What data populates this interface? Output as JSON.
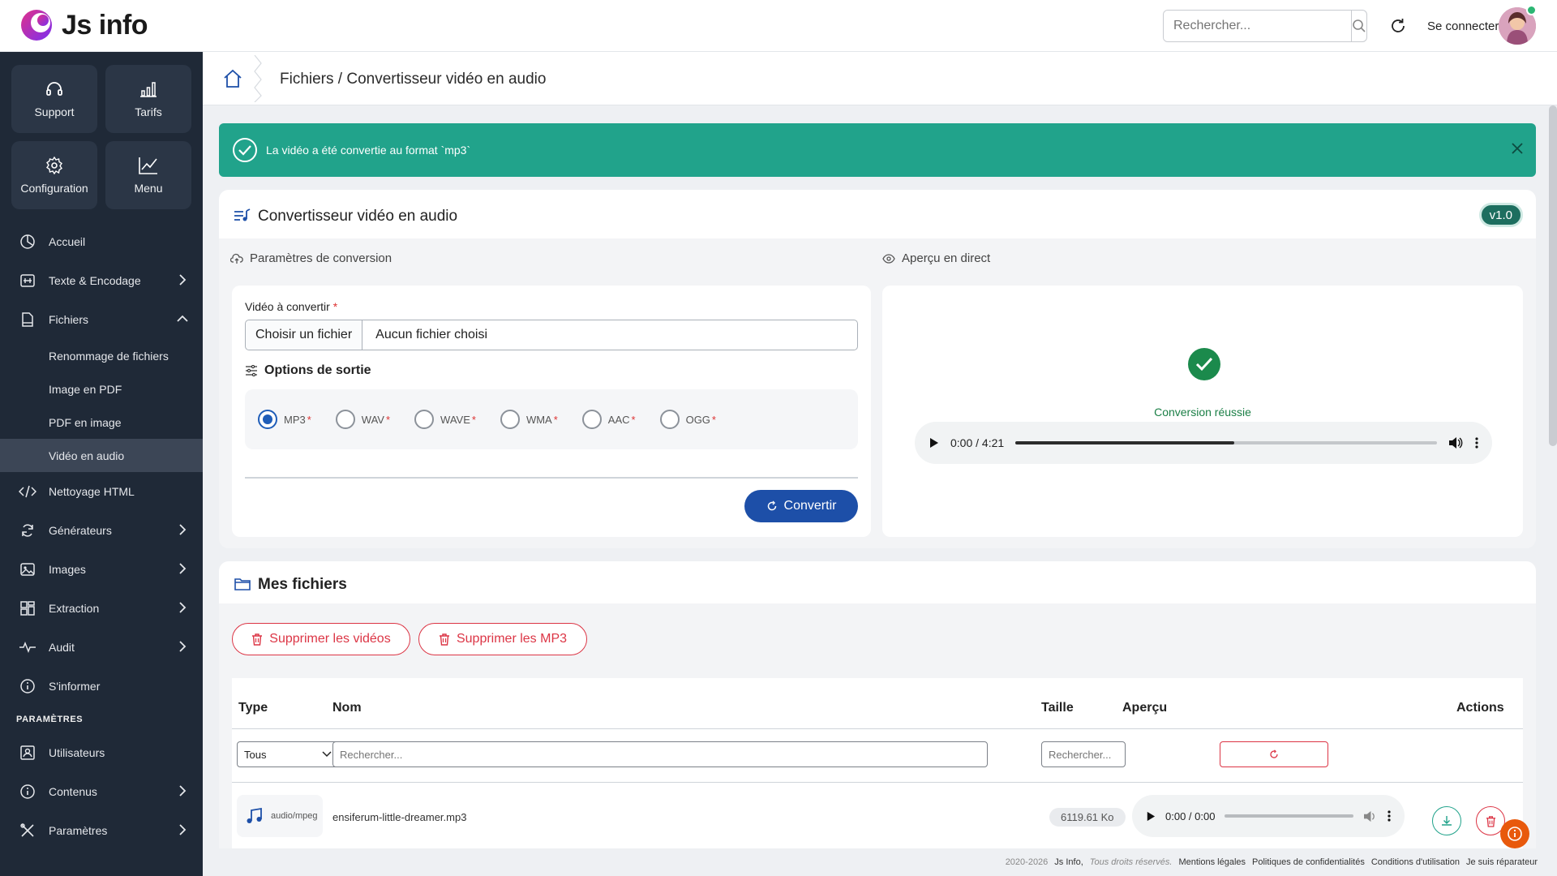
{
  "app": {
    "name": "Js info"
  },
  "topbar": {
    "search_placeholder": "Rechercher...",
    "login_label": "Se connecter"
  },
  "sidebar": {
    "tiles": [
      {
        "label": "Support",
        "icon": "headset-icon"
      },
      {
        "label": "Tarifs",
        "icon": "bar-chart-icon"
      },
      {
        "label": "Configuration",
        "icon": "gear-icon"
      },
      {
        "label": "Menu",
        "icon": "trend-chart-icon"
      }
    ],
    "items": [
      {
        "label": "Accueil",
        "icon": "dashboard-icon"
      },
      {
        "label": "Texte & Encodage",
        "icon": "encoding-icon"
      },
      {
        "label": "Fichiers",
        "icon": "file-icon"
      },
      {
        "label": "Nettoyage HTML",
        "icon": "code-icon"
      },
      {
        "label": "Générateurs",
        "icon": "refresh-icon"
      },
      {
        "label": "Images",
        "icon": "image-icon"
      },
      {
        "label": "Extraction",
        "icon": "grid-icon"
      },
      {
        "label": "Audit",
        "icon": "pulse-icon"
      },
      {
        "label": "S'informer",
        "icon": "info-icon"
      }
    ],
    "sub_items": [
      "Renommage de fichiers",
      "Image en PDF",
      "PDF en image",
      "Vidéo en audio"
    ],
    "section_label": "PARAMÈTRES",
    "settings_items": [
      {
        "label": "Utilisateurs",
        "icon": "user-card-icon"
      },
      {
        "label": "Contenus",
        "icon": "info-icon"
      },
      {
        "label": "Paramètres",
        "icon": "tools-icon"
      }
    ]
  },
  "breadcrumb": {
    "text": "Fichiers / Convertisseur vidéo en audio"
  },
  "alert": {
    "message": "La vidéo a été convertie au format `mp3`"
  },
  "converter": {
    "title": "Convertisseur vidéo en audio",
    "version": "v1.0",
    "params_title": "Paramètres de conversion",
    "preview_title": "Aperçu en direct",
    "field_label": "Vidéo à convertir",
    "required_mark": "*",
    "file_button": "Choisir un fichier",
    "file_name": "Aucun fichier choisi",
    "options_title": "Options de sortie",
    "formats": [
      "MP3",
      "WAV",
      "WAVE",
      "WMA",
      "AAC",
      "OGG"
    ],
    "selected_format": "MP3",
    "convert_label": "Convertir",
    "success_text": "Conversion réussie",
    "player_time": "0:00 / 4:21",
    "player_progress": 0.52
  },
  "files": {
    "title": "Mes fichiers",
    "delete_videos": "Supprimer les vidéos",
    "delete_mp3": "Supprimer les MP3",
    "columns": [
      "Type",
      "Nom",
      "Taille",
      "Aperçu",
      "Actions"
    ],
    "type_filter": "Tous",
    "name_search_placeholder": "Rechercher...",
    "size_search_placeholder": "Rechercher...",
    "rows": [
      {
        "type": "audio/mpeg",
        "name": "ensiferum-little-dreamer.mp3",
        "size": "6119.61 Ko",
        "time": "0:00 / 0:00"
      }
    ]
  },
  "footer": {
    "copyright_years": "2020-2026",
    "brand": "Js Info,",
    "rights": "Tous droits réservés.",
    "links": [
      "Mentions légales",
      "Politiques de confidentialités",
      "Conditions d'utilisation",
      "Je suis réparateur"
    ]
  },
  "colors": {
    "sidebar": "#1f2937",
    "accent": "#1d4fa8",
    "success": "#21a38b",
    "danger": "#dc3545"
  }
}
